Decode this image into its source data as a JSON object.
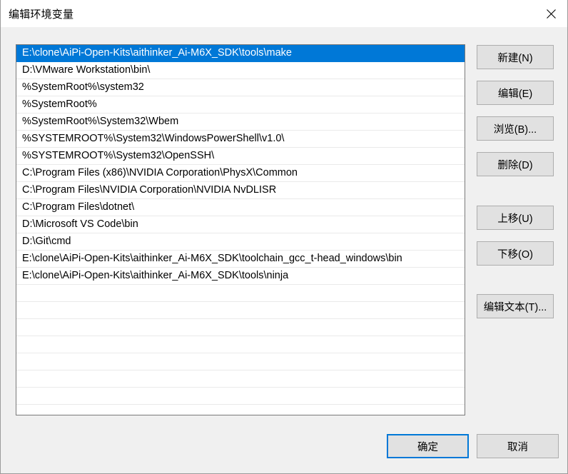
{
  "window": {
    "title": "编辑环境变量",
    "close_icon": "close-icon"
  },
  "colors": {
    "accent": "#0078d7",
    "dialog_bg": "#f0f0f0",
    "button_bg": "#e1e1e1",
    "button_border": "#adadad",
    "listbox_border": "#7a7a7a",
    "titlebar_bg": "#ffffff"
  },
  "list": {
    "selected_index": 0,
    "entries": [
      "E:\\clone\\AiPi-Open-Kits\\aithinker_Ai-M6X_SDK\\tools\\make",
      "D:\\VMware Workstation\\bin\\",
      "%SystemRoot%\\system32",
      "%SystemRoot%",
      "%SystemRoot%\\System32\\Wbem",
      "%SYSTEMROOT%\\System32\\WindowsPowerShell\\v1.0\\",
      "%SYSTEMROOT%\\System32\\OpenSSH\\",
      "C:\\Program Files (x86)\\NVIDIA Corporation\\PhysX\\Common",
      "C:\\Program Files\\NVIDIA Corporation\\NVIDIA NvDLISR",
      "C:\\Program Files\\dotnet\\",
      "D:\\Microsoft VS Code\\bin",
      "D:\\Git\\cmd",
      "E:\\clone\\AiPi-Open-Kits\\aithinker_Ai-M6X_SDK\\toolchain_gcc_t-head_windows\\bin",
      "E:\\clone\\AiPi-Open-Kits\\aithinker_Ai-M6X_SDK\\tools\\ninja"
    ],
    "empty_row_count": 7
  },
  "side_buttons": {
    "new": "新建(N)",
    "edit": "编辑(E)",
    "browse": "浏览(B)...",
    "delete": "删除(D)",
    "move_up": "上移(U)",
    "move_down": "下移(O)",
    "edit_text": "编辑文本(T)..."
  },
  "bottom_buttons": {
    "ok": "确定",
    "cancel": "取消"
  }
}
